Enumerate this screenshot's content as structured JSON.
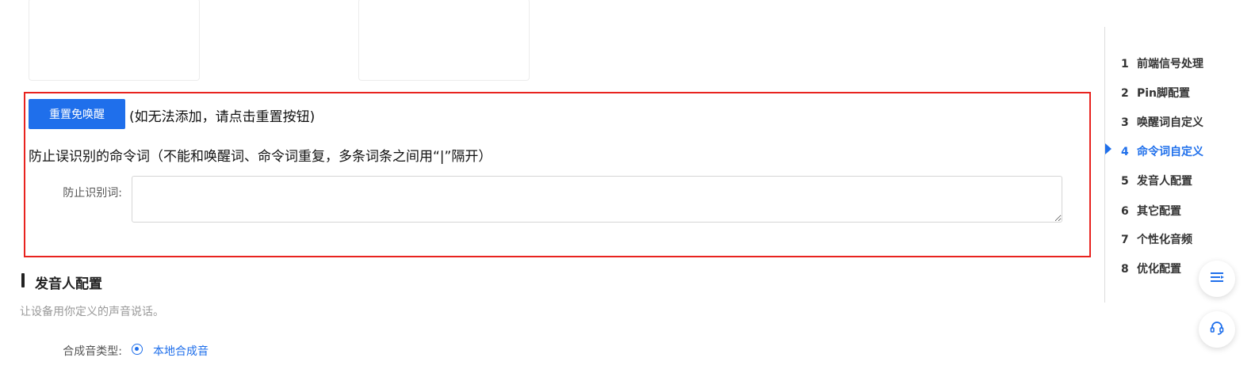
{
  "wake_reset": {
    "button_label": "重置免唤醒",
    "hint": "(如无法添加，请点击重置按钮)"
  },
  "prevent_section": {
    "description": "防止误识别的命令词（不能和唤醒词、命令词重复，多条词条之间用“|”隔开）",
    "field_label": "防止识别词:",
    "field_value": "",
    "field_placeholder": ""
  },
  "speaker_section": {
    "title": "发音人配置",
    "subtitle": "让设备用你定义的声音说话。",
    "tts_label": "合成音类型:",
    "tts_option": "本地合成音"
  },
  "toc": {
    "items": [
      {
        "num": "1",
        "label": "前端信号处理"
      },
      {
        "num": "2",
        "label": "Pin脚配置"
      },
      {
        "num": "3",
        "label": "唤醒词自定义"
      },
      {
        "num": "4",
        "label": "命令词自定义"
      },
      {
        "num": "5",
        "label": "发音人配置"
      },
      {
        "num": "6",
        "label": "其它配置"
      },
      {
        "num": "7",
        "label": "个性化音频"
      },
      {
        "num": "8",
        "label": "优化配置"
      }
    ],
    "active_index": 3
  },
  "colors": {
    "accent": "#1f6feb",
    "highlight_border": "#e8231f"
  },
  "icons": {
    "list": "list-icon",
    "support": "headset-icon",
    "toc_marker": "triangle-right-icon"
  }
}
